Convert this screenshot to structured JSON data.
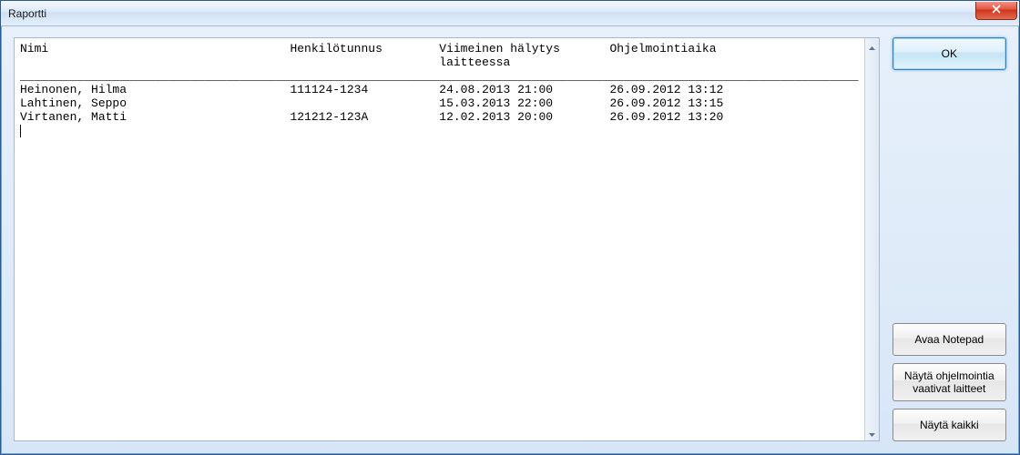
{
  "window": {
    "title": "Raportti"
  },
  "report": {
    "headers": {
      "col1": "Nimi",
      "col2": "Henkilötunnus",
      "col3a": "Viimeinen hälytys",
      "col3b": "laitteessa",
      "col4": "Ohjelmointiaika"
    },
    "rows": [
      {
        "name": "Heinonen, Hilma",
        "ssn": "111124-1234",
        "last_alarm": "24.08.2013 21:00",
        "prog_time": "26.09.2012 13:12"
      },
      {
        "name": "Lahtinen, Seppo",
        "ssn": "",
        "last_alarm": "15.03.2013 22:00",
        "prog_time": "26.09.2012 13:15"
      },
      {
        "name": "Virtanen, Matti",
        "ssn": "121212-123A",
        "last_alarm": "12.02.2013 20:00",
        "prog_time": "26.09.2012 13:20"
      }
    ]
  },
  "buttons": {
    "ok": "OK",
    "open_notepad": "Avaa Notepad",
    "show_prog_needed": "Näytä ohjelmointia vaativat laitteet",
    "show_all": "Näytä kaikki"
  }
}
